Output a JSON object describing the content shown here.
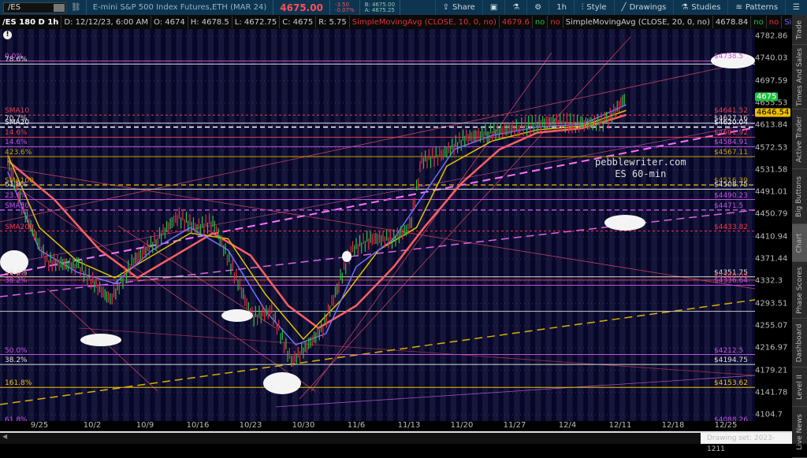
{
  "toolbar": {
    "symbol": "/ES",
    "description": "E-mini S&P 500 Index Futures,ETH (MAR 24)",
    "last": "4675.00",
    "change": "-3.50",
    "change_pct": "-0.07%",
    "bid": "B: 4675.00",
    "ask": "A: 4675.25",
    "buttons": [
      {
        "icon": "share-icon",
        "label": "Share"
      },
      {
        "icon": "alert-icon",
        "label": ""
      },
      {
        "icon": "flask-icon",
        "label": ""
      },
      {
        "icon": "gear-icon",
        "label": ""
      },
      {
        "icon": "",
        "label": "1h"
      },
      {
        "icon": "style-icon",
        "label": "Style"
      },
      {
        "icon": "pencil-icon",
        "label": "Drawings"
      },
      {
        "icon": "flask-icon",
        "label": "Studies"
      },
      {
        "icon": "patterns-icon",
        "label": "Patterns"
      },
      {
        "icon": "menu-icon",
        "label": ""
      }
    ]
  },
  "info": {
    "title": "/ES 180 D 1h",
    "date": "D: 12/12/23, 6:00 AM",
    "open": "O: 4674",
    "high": "H: 4678.5",
    "low": "L: 4672.75",
    "close": "C: 4675",
    "range": "R: 5.75",
    "studies": [
      {
        "name": "SimpleMovingAvg (CLOSE, 10, 0, no)",
        "value": "4679.6",
        "color": "red"
      },
      {
        "name": "SimpleMovingAvg (CLOSE, 20, 0, no)",
        "value": "4678.84",
        "color": "white"
      },
      {
        "name": "SimpleMovingAvg (CLOSE, 50, 0, no)",
        "value": "...",
        "color": "blue"
      }
    ],
    "no": "no"
  },
  "axis": {
    "ticks": [
      "4782.86",
      "4740.03",
      "4697.59",
      "4655.53",
      "4613.84",
      "4572.53",
      "4531.58",
      "4491.01",
      "4450.79",
      "4410.94",
      "4371.44",
      "4332.3",
      "4293.51",
      "4255.07",
      "4216.97",
      "4179.21",
      "4141.78",
      "4104.7"
    ],
    "current": {
      "price": "4675",
      "color": "#1fbf3f"
    },
    "sma": {
      "price": "4646.54",
      "color": "#f0c000"
    }
  },
  "dates": [
    "9/25",
    "10/2",
    "10/9",
    "10/16",
    "10/23",
    "10/30",
    "11/6",
    "11/13",
    "11/20",
    "11/27",
    "12/4",
    "12/11",
    "12/18",
    "12/25"
  ],
  "levels": [
    {
      "price": 4738.5,
      "color": "#d050e0",
      "style": "solid",
      "right": "$4738.5",
      "left": "0.0%"
    },
    {
      "price": 4733,
      "color": "#ddd",
      "style": "solid",
      "right": "",
      "left": "78.6%"
    },
    {
      "price": 4641.52,
      "color": "#e04050",
      "style": "dotted",
      "right": "$4641.52",
      "left": "SMA10"
    },
    {
      "price": 4627.16,
      "color": "#ddd",
      "style": "solid",
      "right": "$4627.16",
      "left": "70.7%"
    },
    {
      "price": 4620.04,
      "color": "#fff",
      "style": "dashed",
      "right": "$4620.04",
      "left": "SMA20"
    },
    {
      "price": 4601.92,
      "color": "#e04050",
      "style": "solid",
      "right": "$4601.92",
      "left": "14.6%"
    },
    {
      "price": 4584.91,
      "color": "#c050e0",
      "style": "solid",
      "right": "$4584.91",
      "left": "14.6%"
    },
    {
      "price": 4567.11,
      "color": "#c8a000",
      "style": "solid",
      "right": "$4567.11",
      "left": "423.6%"
    },
    {
      "price": 4516.39,
      "color": "#c8a000",
      "style": "dashed",
      "right": "$4516.39",
      "left": "SMA100"
    },
    {
      "price": 4508.75,
      "color": "#ddd",
      "style": "solid",
      "right": "$4508.75",
      "left": "61.8%"
    },
    {
      "price": 4490.23,
      "color": "#c050e0",
      "style": "solid",
      "right": "$4490.23",
      "left": "23.6%"
    },
    {
      "price": 4471.5,
      "color": "#c050e0",
      "style": "dashed",
      "right": "$4471.5",
      "left": "SMA50"
    },
    {
      "price": 4433.82,
      "color": "#ff3040",
      "style": "dotted",
      "right": "$4433.82",
      "left": "SMA200"
    },
    {
      "price": 4351.75,
      "color": "#ddd",
      "style": "solid",
      "right": "$4351.75",
      "left": "50.0%"
    },
    {
      "price": 4346.03,
      "color": "#e04050",
      "style": "solid",
      "right": "$4346.03",
      "left": "23.6%"
    },
    {
      "price": 4336.64,
      "color": "#c050e0",
      "style": "solid",
      "right": "$4336.64",
      "left": "38.2%"
    },
    {
      "price": 4290,
      "color": "#ccc",
      "style": "solid",
      "right": "",
      "left": ""
    },
    {
      "price": 4212.5,
      "color": "#c050e0",
      "style": "solid",
      "right": "$4212.5",
      "left": "50.0%"
    },
    {
      "price": 4194.75,
      "color": "#ddd",
      "style": "solid",
      "right": "$4194.75",
      "left": "38.2%"
    },
    {
      "price": 4153.62,
      "color": "#f0c000",
      "style": "solid",
      "right": "$4153.62",
      "left": "161.8%"
    },
    {
      "price": 4088.26,
      "color": "#c050e0",
      "style": "solid",
      "right": "$4088.26",
      "left": "61.8%"
    }
  ],
  "price_series": [
    [
      -4.2,
      4560
    ],
    [
      -2.1,
      4470
    ],
    [
      1,
      4380
    ],
    [
      5.2,
      4370
    ],
    [
      9.4,
      4310
    ],
    [
      12.5,
      4380
    ],
    [
      15.7,
      4420
    ],
    [
      18.3,
      4460
    ],
    [
      20.9,
      4440
    ],
    [
      23,
      4450
    ],
    [
      26.1,
      4350
    ],
    [
      28.2,
      4280
    ],
    [
      30.8,
      4290
    ],
    [
      33.4,
      4200
    ],
    [
      35,
      4220
    ],
    [
      37.6,
      4260
    ],
    [
      39.7,
      4340
    ],
    [
      41.3,
      4400
    ],
    [
      43.9,
      4420
    ],
    [
      47,
      4420
    ],
    [
      49.1,
      4440
    ],
    [
      50.7,
      4560
    ],
    [
      53.3,
      4570
    ],
    [
      56.4,
      4600
    ],
    [
      59.6,
      4610
    ],
    [
      63.7,
      4620
    ],
    [
      67.9,
      4630
    ],
    [
      72,
      4625
    ],
    [
      75.2,
      4630
    ],
    [
      77.8,
      4675
    ]
  ],
  "sma10": [
    [
      -4.2,
      4540
    ],
    [
      0,
      4400
    ],
    [
      5,
      4360
    ],
    [
      10,
      4340
    ],
    [
      15,
      4400
    ],
    [
      20,
      4440
    ],
    [
      25,
      4400
    ],
    [
      30,
      4290
    ],
    [
      34,
      4230
    ],
    [
      38,
      4250
    ],
    [
      42,
      4370
    ],
    [
      47,
      4420
    ],
    [
      51,
      4500
    ],
    [
      55,
      4580
    ],
    [
      60,
      4605
    ],
    [
      66,
      4620
    ],
    [
      72,
      4625
    ],
    [
      77.8,
      4660
    ]
  ],
  "sma20": [
    [
      -4.2,
      4570
    ],
    [
      0,
      4440
    ],
    [
      5,
      4380
    ],
    [
      10,
      4350
    ],
    [
      15,
      4390
    ],
    [
      20,
      4430
    ],
    [
      25,
      4420
    ],
    [
      30,
      4320
    ],
    [
      35,
      4240
    ],
    [
      40,
      4310
    ],
    [
      45,
      4400
    ],
    [
      50,
      4440
    ],
    [
      54,
      4550
    ],
    [
      60,
      4595
    ],
    [
      66,
      4615
    ],
    [
      72,
      4622
    ],
    [
      77.8,
      4650
    ]
  ],
  "sma50": [
    [
      -4.2,
      4560
    ],
    [
      2,
      4490
    ],
    [
      8,
      4400
    ],
    [
      13,
      4350
    ],
    [
      18,
      4390
    ],
    [
      23,
      4430
    ],
    [
      28,
      4390
    ],
    [
      33,
      4300
    ],
    [
      37,
      4260
    ],
    [
      42,
      4300
    ],
    [
      47,
      4370
    ],
    [
      51,
      4440
    ],
    [
      56,
      4520
    ],
    [
      61,
      4580
    ],
    [
      66,
      4610
    ],
    [
      72,
      4618
    ],
    [
      77.8,
      4642
    ]
  ],
  "watermark": [
    "pebblewriter.com",
    "ES 60-min"
  ],
  "drawing_set": "Drawing set: 2023-1211",
  "tabs": [
    {
      "label": "Trade"
    },
    {
      "label": "Times And Sales"
    },
    {
      "label": "Active Trader"
    },
    {
      "label": "Big Buttons"
    },
    {
      "label": "Chart",
      "selected": true
    },
    {
      "label": "Phase Scores"
    },
    {
      "label": "Dashboard"
    },
    {
      "label": "Level II"
    },
    {
      "label": "Live News"
    }
  ]
}
